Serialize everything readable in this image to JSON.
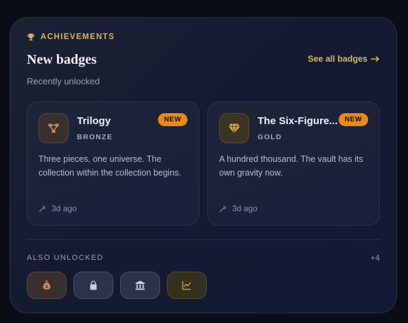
{
  "header": {
    "eyebrow": "ACHIEVEMENTS",
    "eyebrow_icon": "trophy-icon",
    "title": "New badges",
    "subtitle": "Recently unlocked",
    "see_all_label": "See all badges"
  },
  "badges": [
    {
      "name": "Trilogy",
      "tier": "BRONZE",
      "icon": "share-nodes-icon",
      "new_label": "NEW",
      "description": "Three pieces, one universe. The collection within the collection begins.",
      "time": "3d ago"
    },
    {
      "name": "The Six-Figure Vault",
      "name_visible": "The Six-Figure...",
      "tier": "GOLD",
      "icon": "gem-icon",
      "new_label": "NEW",
      "description": "A hundred thousand. The vault has its own gravity now.",
      "time": "3d ago"
    }
  ],
  "also_unlocked": {
    "label": "ALSO UNLOCKED",
    "count": "+4",
    "chips": [
      {
        "icon": "money-bag-icon",
        "tier": "bronze"
      },
      {
        "icon": "lock-icon",
        "tier": "silver"
      },
      {
        "icon": "bank-icon",
        "tier": "silver"
      },
      {
        "icon": "chart-line-icon",
        "tier": "gold"
      }
    ]
  },
  "colors": {
    "accent_gold": "#d7b46a",
    "new_pill": "#e8891c",
    "bronze": "#c88a5e",
    "gold": "#e3a33a",
    "silver": "#c9cfdc"
  }
}
